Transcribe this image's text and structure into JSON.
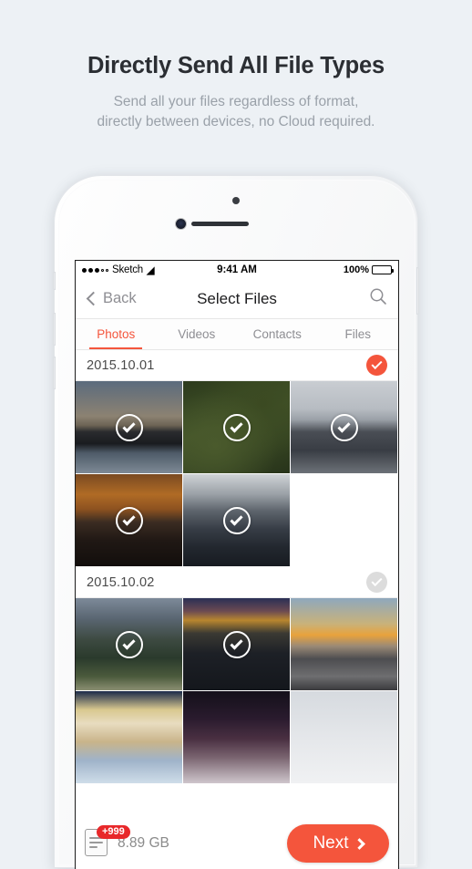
{
  "promo": {
    "title": "Directly Send All File Types",
    "subtitle_line1": "Send all your files regardless of format,",
    "subtitle_line2": "directly between devices, no Cloud required."
  },
  "status_bar": {
    "carrier": "Sketch",
    "wifi_icon": "wifi-icon",
    "time": "9:41 AM",
    "battery_percent": "100%"
  },
  "nav_bar": {
    "back_label": "Back",
    "back_icon": "chevron-left-icon",
    "title": "Select Files",
    "search_icon": "search-icon"
  },
  "tabs": [
    {
      "label": "Photos",
      "active": true
    },
    {
      "label": "Videos",
      "active": false
    },
    {
      "label": "Contacts",
      "active": false
    },
    {
      "label": "Files",
      "active": false
    }
  ],
  "sections": [
    {
      "date": "2015.10.01",
      "selected": true,
      "check_icon": "check-circle-filled-icon",
      "photos": [
        {
          "name": "foggy-sunset-coast",
          "art": "ph-fogsunset",
          "selected": true
        },
        {
          "name": "aerial-green-hills",
          "art": "ph-aerial",
          "selected": true
        },
        {
          "name": "snowy-highway",
          "art": "ph-snowroad",
          "selected": true
        },
        {
          "name": "orange-sunset-peaks",
          "art": "ph-orangemtn",
          "selected": true
        },
        {
          "name": "matterhorn-summit",
          "art": "ph-matterhorn",
          "selected": true
        },
        {
          "name": "empty-slot",
          "art": "empty",
          "selected": false
        }
      ]
    },
    {
      "date": "2015.10.02",
      "selected": false,
      "check_icon": "check-circle-outline-icon",
      "photos": [
        {
          "name": "mountain-with-cabin",
          "art": "ph-cabinmtn",
          "selected": true
        },
        {
          "name": "night-city-skyline",
          "art": "ph-city",
          "selected": true
        },
        {
          "name": "skateboarder-sunset",
          "art": "ph-skate",
          "selected": false
        },
        {
          "name": "carnival-lights",
          "art": "ph-carnival",
          "selected": false
        },
        {
          "name": "milky-way-sky",
          "art": "ph-galaxy",
          "selected": false
        },
        {
          "name": "pale-backdrop",
          "art": "ph-blank",
          "selected": false
        }
      ]
    }
  ],
  "bottom_bar": {
    "doc_icon": "document-icon",
    "badge": "+999",
    "size": "8.89 GB",
    "next_label": "Next",
    "next_icon": "chevron-right-icon"
  },
  "colors": {
    "accent": "#F4553C",
    "badge_red": "#E8282A",
    "page_background": "#EDF1F5",
    "muted_text": "#8E8E93"
  }
}
